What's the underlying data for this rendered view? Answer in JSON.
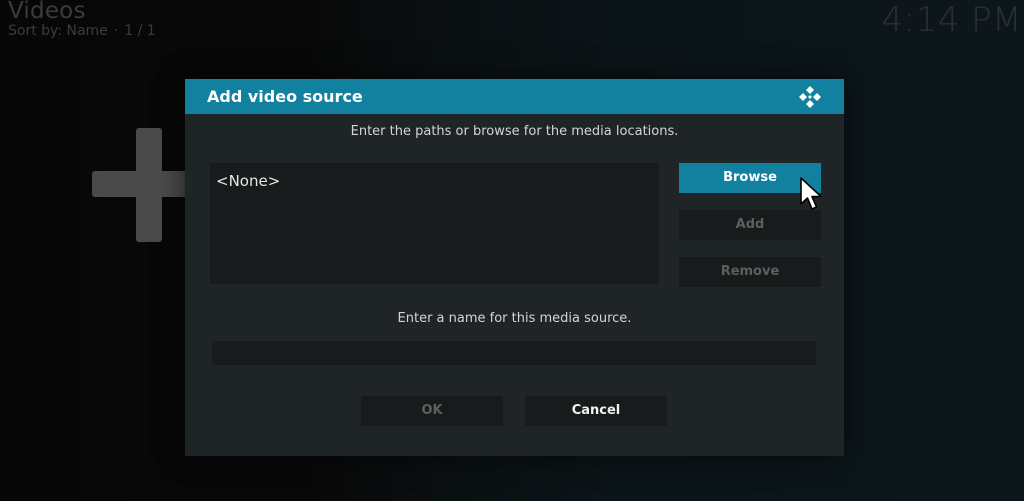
{
  "header": {
    "title": "Videos",
    "sort_label": "Sort by: Name",
    "separator": "·",
    "page_count": "1 / 1",
    "clock": "4:14 PM"
  },
  "dialog": {
    "title": "Add video source",
    "instruction_paths": "Enter the paths or browse for the media locations.",
    "paths": [
      "<None>"
    ],
    "buttons": {
      "browse": "Browse",
      "add": "Add",
      "remove": "Remove",
      "ok": "OK",
      "cancel": "Cancel"
    },
    "instruction_name": "Enter a name for this media source.",
    "name_value": ""
  },
  "icons": {
    "background_add": "plus-icon",
    "logo": "kodi-logo-icon",
    "cursor": "mouse-pointer-icon"
  },
  "colors": {
    "accent": "#12809f",
    "dialog_bg": "#1f2527",
    "field_bg": "#181b1c",
    "disabled_text": "#5e5e5e"
  }
}
